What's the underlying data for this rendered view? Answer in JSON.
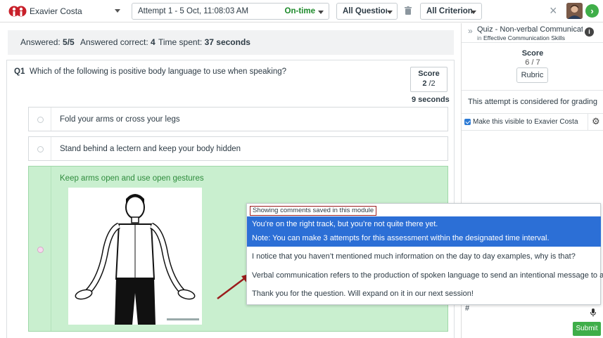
{
  "topbar": {
    "student_name": "Exavier Costa",
    "attempt_label": "Attempt 1 - 5 Oct, 11:08:03 AM",
    "attempt_status": "On-time",
    "questions_filter": "All Questions",
    "criterion_filter": "All Criterion",
    "next_symbol": "›",
    "close_symbol": "×"
  },
  "summary": {
    "answered_label": "Answered:",
    "answered_value": "5/5",
    "correct_label": "Answered correct:",
    "correct_value": "4",
    "time_label": "Time spent:",
    "time_value": "37 seconds"
  },
  "question": {
    "number": "Q1",
    "text": "Which of the following is positive body language to use when speaking?",
    "score_label": "Score",
    "score_value": "2",
    "score_max": "/2",
    "time": "9 seconds",
    "options": [
      "Fold your arms or cross your legs",
      "Stand behind a lectern and keep your body hidden",
      "Keep arms open and use open gestures"
    ]
  },
  "sidebar": {
    "quiz_title": "Quiz - Non-verbal Communication",
    "quiz_in_prefix": "in",
    "quiz_course": "Effective Communication Skills",
    "score_label": "Score",
    "score_value": "6 / 7",
    "rubric_label": "Rubric",
    "grading_note": "This attempt is considered for grading",
    "visible_label": "Make this visible to Exavier Costa",
    "comment_text": "#",
    "submit_label": "Submit"
  },
  "comments_popup": {
    "header": "Showing comments saved in this module",
    "selected_line1": "You’re on the right track, but you’re not quite there yet.",
    "selected_line2": "Note: You can make 3 attempts for this assessment within the designated time interval.",
    "items": [
      "I notice that you haven’t mentioned much information on the day to day examples, why is that?",
      "Verbal communication refers to the production of spoken language to send an intentional message to a listener.",
      "Thank you for the question. Will expand on it in our next session!"
    ]
  },
  "colors": {
    "accent_green": "#3fae49",
    "correct_bg": "#c9efcf",
    "selection_blue": "#2c6fd6",
    "annotation_red": "#9b1c1c"
  }
}
